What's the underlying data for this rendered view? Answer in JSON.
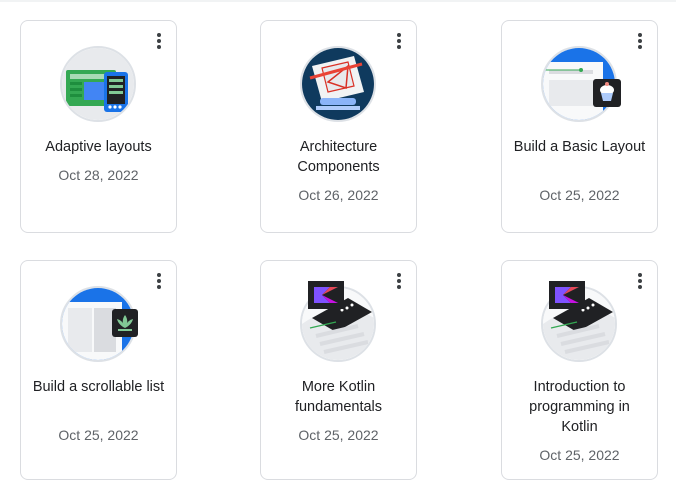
{
  "courses": [
    {
      "title": "Adaptive layouts",
      "date": "Oct 28, 2022",
      "icon": "tablet-phone-icon"
    },
    {
      "title": "Architecture Components",
      "date": "Oct 26, 2022",
      "icon": "blueprint-ruler-icon"
    },
    {
      "title": "Build a Basic Layout",
      "date": "Oct 25, 2022",
      "icon": "cupcake-layout-icon"
    },
    {
      "title": "Build a scrollable list",
      "date": "Oct 25, 2022",
      "icon": "lotus-list-icon"
    },
    {
      "title": "More Kotlin fundamentals",
      "date": "Oct 25, 2022",
      "icon": "kotlin-code-icon"
    },
    {
      "title": "Introduction to programming in Kotlin",
      "date": "Oct 25, 2022",
      "icon": "kotlin-intro-icon"
    }
  ]
}
